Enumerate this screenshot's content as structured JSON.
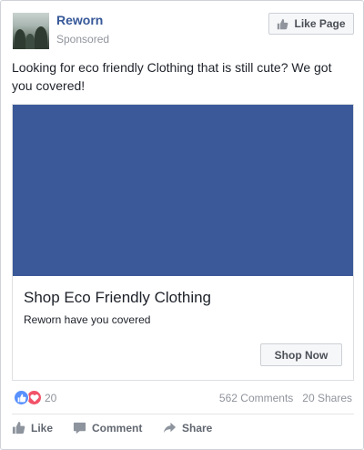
{
  "header": {
    "page_name": "Reworn",
    "sponsored": "Sponsored",
    "like_page_label": "Like Page",
    "avatar_icon": "forest-photo-icon"
  },
  "post": {
    "message": "Looking for eco friendly Clothing that is still cute? We got you covered!"
  },
  "ad": {
    "image_color": "#3b5998",
    "headline": "Shop Eco Friendly Clothing",
    "description": "Reworn have you covered",
    "cta_label": "Shop Now"
  },
  "reactions": {
    "icons": [
      "like-reaction-icon",
      "love-reaction-icon"
    ],
    "count": "20",
    "comments": "562 Comments",
    "shares": "20 Shares"
  },
  "actions": {
    "like_label": "Like",
    "comment_label": "Comment",
    "share_label": "Share"
  },
  "colors": {
    "brand_link": "#365899",
    "like_blue": "#5890ff",
    "love_red": "#f25268",
    "muted_text": "#90949c"
  }
}
